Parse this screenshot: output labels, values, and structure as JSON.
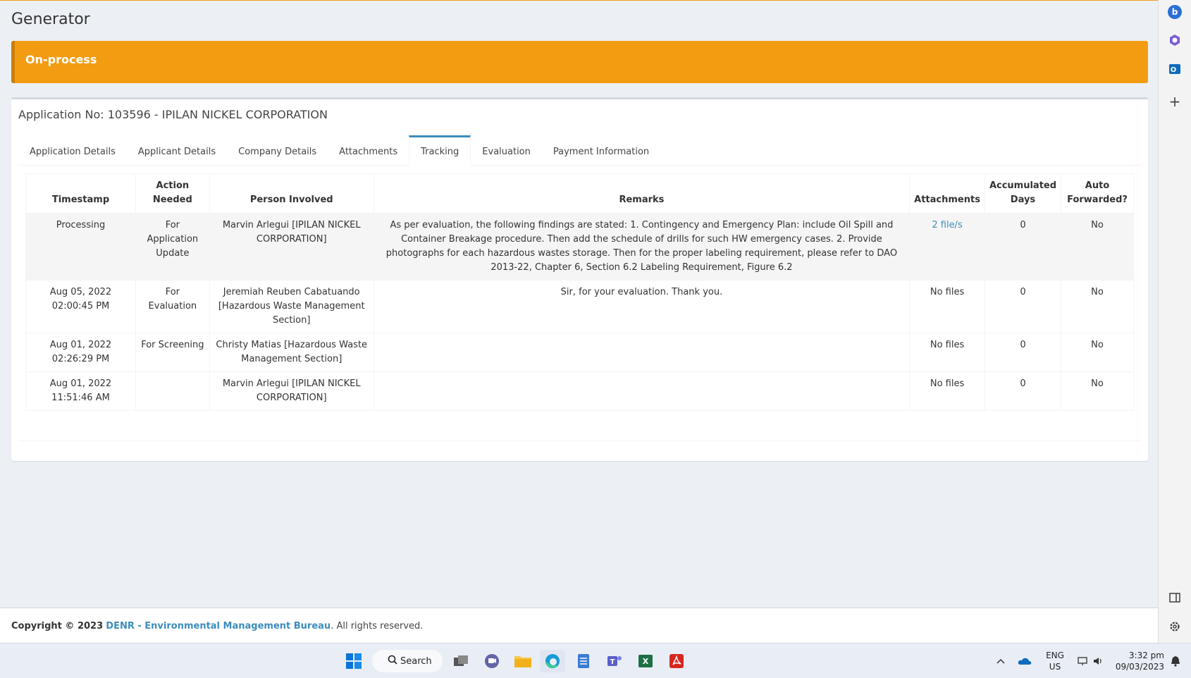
{
  "page": {
    "title": "Generator"
  },
  "status": {
    "label": "On-process",
    "color": "#f39c12"
  },
  "application": {
    "heading": "Application No: 103596 - IPILAN NICKEL CORPORATION"
  },
  "tabs": [
    {
      "label": "Application Details"
    },
    {
      "label": "Applicant Details"
    },
    {
      "label": "Company Details"
    },
    {
      "label": "Attachments"
    },
    {
      "label": "Tracking",
      "active": true
    },
    {
      "label": "Evaluation"
    },
    {
      "label": "Payment Information"
    }
  ],
  "table": {
    "headers": {
      "timestamp": "Timestamp",
      "action": "Action Needed",
      "person": "Person Involved",
      "remarks": "Remarks",
      "attachments": "Attachments",
      "days": "Accumulated Days",
      "auto": "Auto Forwarded?"
    },
    "rows": [
      {
        "timestamp": "Processing",
        "action": "For Application Update",
        "person": "Marvin Arlegui [IPILAN NICKEL CORPORATION]",
        "remarks": "As per evaluation, the following findings are stated: 1. Contingency and Emergency Plan: include Oil Spill and Container Breakage procedure. Then add the schedule of drills for such HW emergency cases. 2. Provide photographs for each hazardous wastes storage. Then for the proper labeling requirement, please refer to DAO 2013-22, Chapter 6, Section 6.2 Labeling Requirement, Figure 6.2",
        "attachments": "2 file/s",
        "days": "0",
        "auto": "No"
      },
      {
        "timestamp": "Aug 05, 2022 02:00:45 PM",
        "action": "For Evaluation",
        "person": "Jeremiah Reuben Cabatuando [Hazardous Waste Management Section]",
        "remarks": "Sir, for your evaluation. Thank you.",
        "attachments": "No files",
        "days": "0",
        "auto": "No"
      },
      {
        "timestamp": "Aug 01, 2022 02:26:29 PM",
        "action": "For Screening",
        "person": "Christy Matias [Hazardous Waste Management Section]",
        "remarks": "",
        "attachments": "No files",
        "days": "0",
        "auto": "No"
      },
      {
        "timestamp": "Aug 01, 2022 11:51:46 AM",
        "action": "",
        "person": "Marvin Arlegui [IPILAN NICKEL CORPORATION]",
        "remarks": "",
        "attachments": "No files",
        "days": "0",
        "auto": "No"
      }
    ]
  },
  "footer": {
    "copyright": "Copyright © 2023",
    "org": "DENR - Environmental Management Bureau",
    "rights": ". All rights reserved."
  },
  "taskbar": {
    "search": "Search",
    "lang1": "ENG",
    "lang2": "US",
    "time": "3:32 pm",
    "date": "09/03/2023"
  }
}
